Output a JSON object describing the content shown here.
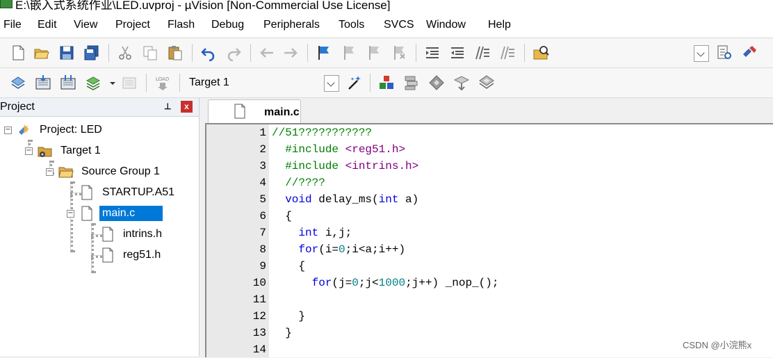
{
  "window": {
    "title": "E:\\嵌入式系统作业\\LED.uvproj - µVision  [Non-Commercial Use License]"
  },
  "menu": [
    "File",
    "Edit",
    "View",
    "Project",
    "Flash",
    "Debug",
    "Peripherals",
    "Tools",
    "SVCS",
    "Window",
    "Help"
  ],
  "toolbar2": {
    "target": "Target 1"
  },
  "project_panel": {
    "title": "Project",
    "close": "x",
    "tree": [
      {
        "label": "Project: LED"
      },
      {
        "label": "Target 1"
      },
      {
        "label": "Source Group 1"
      },
      {
        "label": "STARTUP.A51"
      },
      {
        "label": "main.c",
        "selected": true
      },
      {
        "label": "intrins.h"
      },
      {
        "label": "reg51.h"
      }
    ]
  },
  "editor": {
    "tab": "main.c",
    "lines": [
      {
        "n": "1",
        "parts": [
          [
            "cm",
            "//51???????????"
          ]
        ]
      },
      {
        "n": "2",
        "parts": [
          [
            "pp",
            "  #include "
          ],
          [
            "str",
            "<reg51.h>"
          ]
        ]
      },
      {
        "n": "3",
        "parts": [
          [
            "pp",
            "  #include "
          ],
          [
            "str",
            "<intrins.h>"
          ]
        ]
      },
      {
        "n": "4",
        "parts": [
          [
            "cm",
            "  //????"
          ]
        ]
      },
      {
        "n": "5",
        "parts": [
          [
            "kw",
            "  void "
          ],
          [
            "fn",
            "delay_ms("
          ],
          [
            "kw",
            "int"
          ],
          [
            "fn",
            " a)"
          ]
        ]
      },
      {
        "n": "6",
        "parts": [
          [
            "fn",
            "  {"
          ]
        ]
      },
      {
        "n": "7",
        "parts": [
          [
            "kw",
            "    int "
          ],
          [
            "fn",
            "i,j;"
          ]
        ]
      },
      {
        "n": "8",
        "parts": [
          [
            "kw",
            "    for"
          ],
          [
            "fn",
            "(i="
          ],
          [
            "num",
            "0"
          ],
          [
            "fn",
            ";i<a;i++)"
          ]
        ]
      },
      {
        "n": "9",
        "parts": [
          [
            "fn",
            "    {"
          ]
        ]
      },
      {
        "n": "10",
        "parts": [
          [
            "kw",
            "      for"
          ],
          [
            "fn",
            "(j="
          ],
          [
            "num",
            "0"
          ],
          [
            "fn",
            ";j<"
          ],
          [
            "num",
            "1000"
          ],
          [
            "fn",
            ";j++) _nop_();"
          ]
        ]
      },
      {
        "n": "11",
        "parts": [
          [
            "fn",
            ""
          ]
        ]
      },
      {
        "n": "12",
        "parts": [
          [
            "fn",
            "    }"
          ]
        ]
      },
      {
        "n": "13",
        "parts": [
          [
            "fn",
            "  }"
          ]
        ]
      },
      {
        "n": "14",
        "parts": [
          [
            "fn",
            ""
          ]
        ]
      }
    ]
  },
  "watermark": "CSDN @小浣熊x",
  "colors": {
    "selection": "#0078d7",
    "keyword": "#0000e0",
    "comment": "#008000",
    "string": "#800080",
    "number": "#008080"
  }
}
